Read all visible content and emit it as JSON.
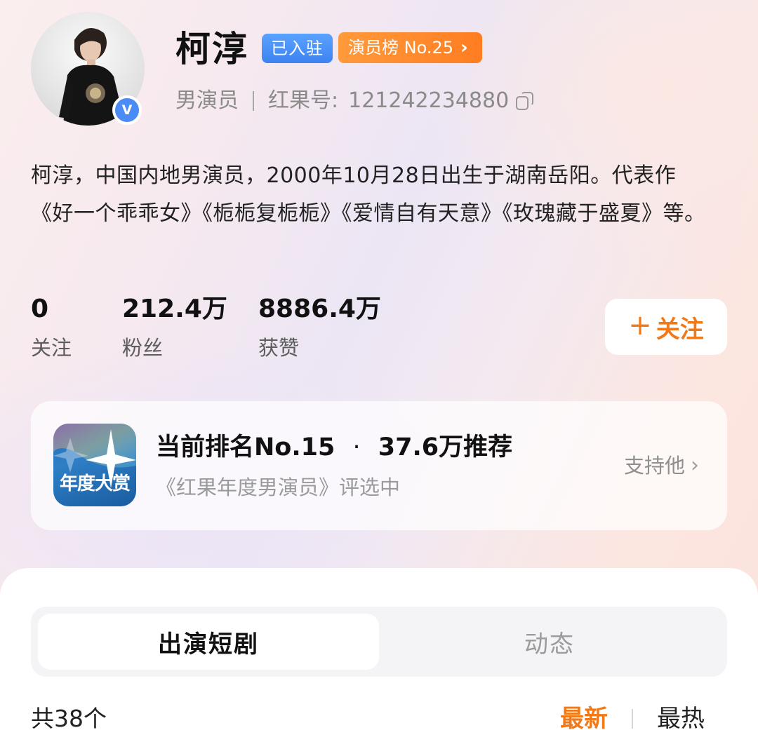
{
  "profile": {
    "name": "柯淳",
    "settled_tag": "已入驻",
    "rank_tag": "演员榜 No.25",
    "role": "男演员",
    "id_label": "红果号:",
    "id_value": "121242234880",
    "verified_mark": "V",
    "bio": "柯淳，中国内地男演员，2000年10月28日出生于湖南岳阳。代表作《好一个乖乖女》《栀栀复栀栀》《爱情自有天意》《玫瑰藏于盛夏》等。"
  },
  "stats": [
    {
      "value": "0",
      "label": "关注"
    },
    {
      "value": "212.4万",
      "label": "粉丝"
    },
    {
      "value": "8886.4万",
      "label": "获赞"
    }
  ],
  "follow_button": {
    "plus": "+",
    "label": "关注"
  },
  "award": {
    "logo_text": "年度大赏",
    "rank_text": "当前排名No.15",
    "dot": "·",
    "recommend_text": "37.6万推荐",
    "subtitle": "《红果年度男演员》评选中",
    "support_label": "支持他",
    "support_chevron": "›"
  },
  "tabs": [
    {
      "label": "出演短剧",
      "active": true
    },
    {
      "label": "动态",
      "active": false
    }
  ],
  "list": {
    "count_text": "共38个",
    "sort_new": "最新",
    "sort_hot": "最热"
  },
  "colors": {
    "accent_orange": "#f07a1a",
    "verify_blue": "#4b8bf5",
    "settled_blue": "#3d83f2"
  },
  "icons": {
    "copy": "copy-icon",
    "verify": "verified-badge-icon",
    "rank_chevron": "chevron-right-icon"
  }
}
